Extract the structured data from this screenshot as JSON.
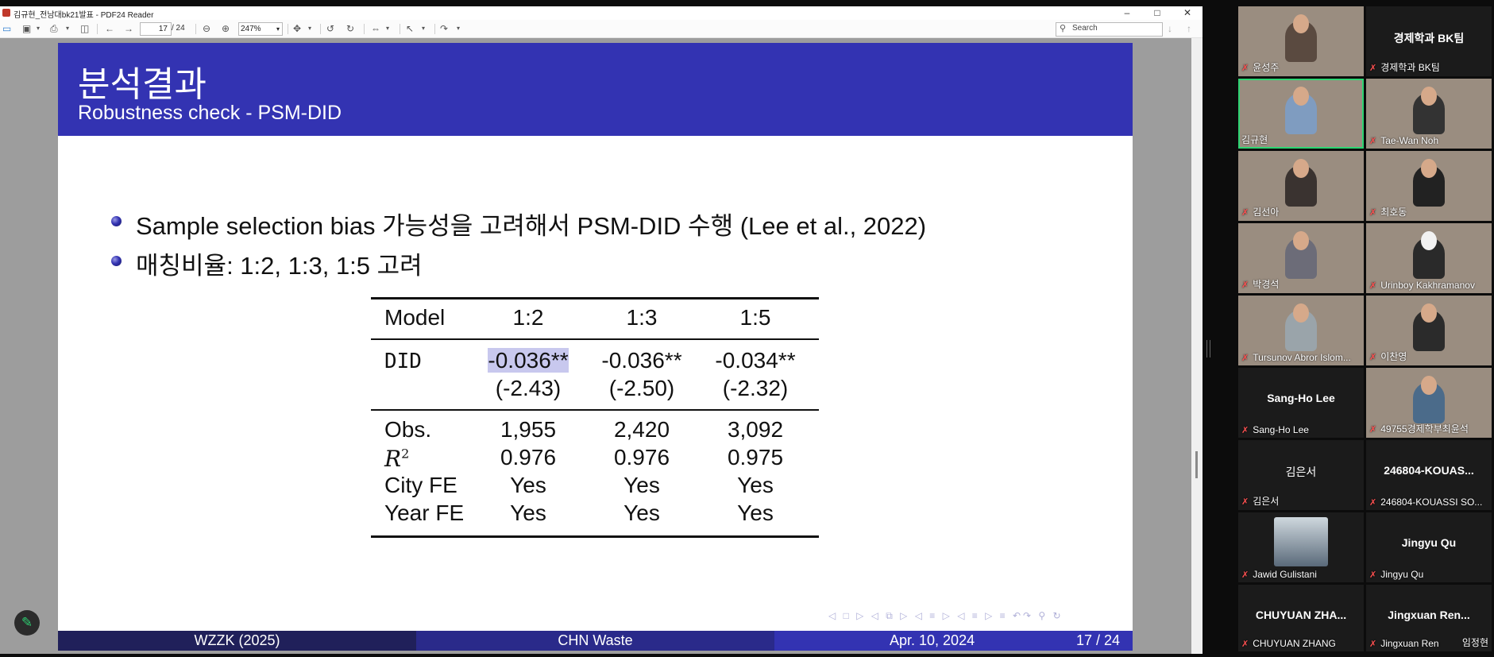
{
  "window": {
    "title": "김규현_전남대bk21발표 - PDF24 Reader",
    "minimize": "‒",
    "maximize": "□",
    "close": "✕"
  },
  "toolbar": {
    "page_current": "17",
    "page_total": "/ 24",
    "zoom": "247%",
    "search_placeholder": "Search"
  },
  "slide": {
    "title": "분석결과",
    "subtitle": "Robustness check - PSM-DID",
    "bullets": [
      "Sample selection bias 가능성을 고려해서 PSM-DID 수행 (Lee et al., 2022)",
      "매칭비율: 1:2, 1:3, 1:5 고려"
    ],
    "table": {
      "headers": [
        "Model",
        "1:2",
        "1:3",
        "1:5"
      ],
      "did_label": "DID",
      "coefficients": [
        "-0.036**",
        "-0.036**",
        "-0.034**"
      ],
      "t_stats": [
        "(-2.43)",
        "(-2.50)",
        "(-2.32)"
      ],
      "rows": [
        {
          "label": "Obs.",
          "values": [
            "1,955",
            "2,420",
            "3,092"
          ]
        },
        {
          "label": "R",
          "sup": "2",
          "values": [
            "0.976",
            "0.976",
            "0.975"
          ]
        },
        {
          "label": "City FE",
          "values": [
            "Yes",
            "Yes",
            "Yes"
          ]
        },
        {
          "label": "Year FE",
          "values": [
            "Yes",
            "Yes",
            "Yes"
          ]
        }
      ]
    },
    "nav_symbols": "◁ □ ▷ ◁ ⧉ ▷ ◁ ≡ ▷ ◁ ≡ ▷   ≡   ↶↷ ⚲ ↻",
    "footer": {
      "left": "WZZK (2025)",
      "center": "CHN Waste",
      "date": "Apr. 10, 2024",
      "page": "17 / 24"
    }
  },
  "participants": [
    {
      "name": "윤성주",
      "video": true
    },
    {
      "name": "경제학과 BK팀",
      "display": "경제학과 BK팀",
      "video": false
    },
    {
      "name": "김규현",
      "video": true,
      "active": true
    },
    {
      "name": "Tae-Wan Noh",
      "video": true
    },
    {
      "name": "김선아",
      "video": true
    },
    {
      "name": "최호동",
      "video": true
    },
    {
      "name": "박경석",
      "video": true
    },
    {
      "name": "Urinboy Kakhramanov",
      "video": true
    },
    {
      "name": "Tursunov Abror Islom...",
      "video": true
    },
    {
      "name": "이찬영",
      "video": true
    },
    {
      "name": "Sang-Ho Lee",
      "display": "Sang-Ho Lee",
      "video": false
    },
    {
      "name": "49755경제학부최윤석",
      "video": true
    },
    {
      "name": "김은서",
      "display": "김은서",
      "video": false
    },
    {
      "name": "246804-KOUASSI SO...",
      "display": "246804-KOUAS...",
      "video": false
    },
    {
      "name": "Jawid Gulistani",
      "video": true,
      "small": true
    },
    {
      "name": "Jingyu Qu",
      "display": "Jingyu Qu",
      "video": false
    },
    {
      "name": "CHUYUAN ZHANG",
      "display": "CHUYUAN ZHA...",
      "video": false
    },
    {
      "name": "Jingxuan Ren",
      "display": "Jingxuan Ren...",
      "video": false,
      "extra": "임정현"
    }
  ]
}
